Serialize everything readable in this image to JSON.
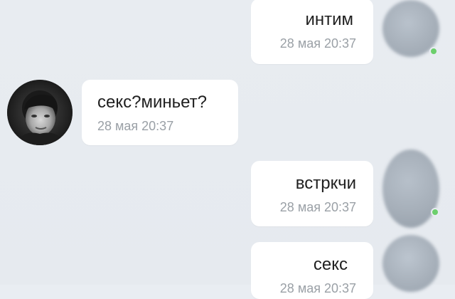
{
  "messages": [
    {
      "direction": "outgoing",
      "text": "интим",
      "time": "28 мая 20:37"
    },
    {
      "direction": "incoming",
      "text": "секс?миньет?",
      "time": "28 мая 20:37"
    },
    {
      "direction": "outgoing",
      "text": "встркчи",
      "time": "28 мая 20:37"
    },
    {
      "direction": "outgoing",
      "text": "секс",
      "time": "28 мая 20:37"
    }
  ],
  "icons": {
    "user_avatar": "blurred-user-avatar",
    "contact_avatar": "contact-avatar"
  },
  "colors": {
    "background": "#e9edf2",
    "bubble": "#ffffff",
    "text": "#1f1f1f",
    "time": "#9aa0a6",
    "online": "#6ccf6c"
  }
}
